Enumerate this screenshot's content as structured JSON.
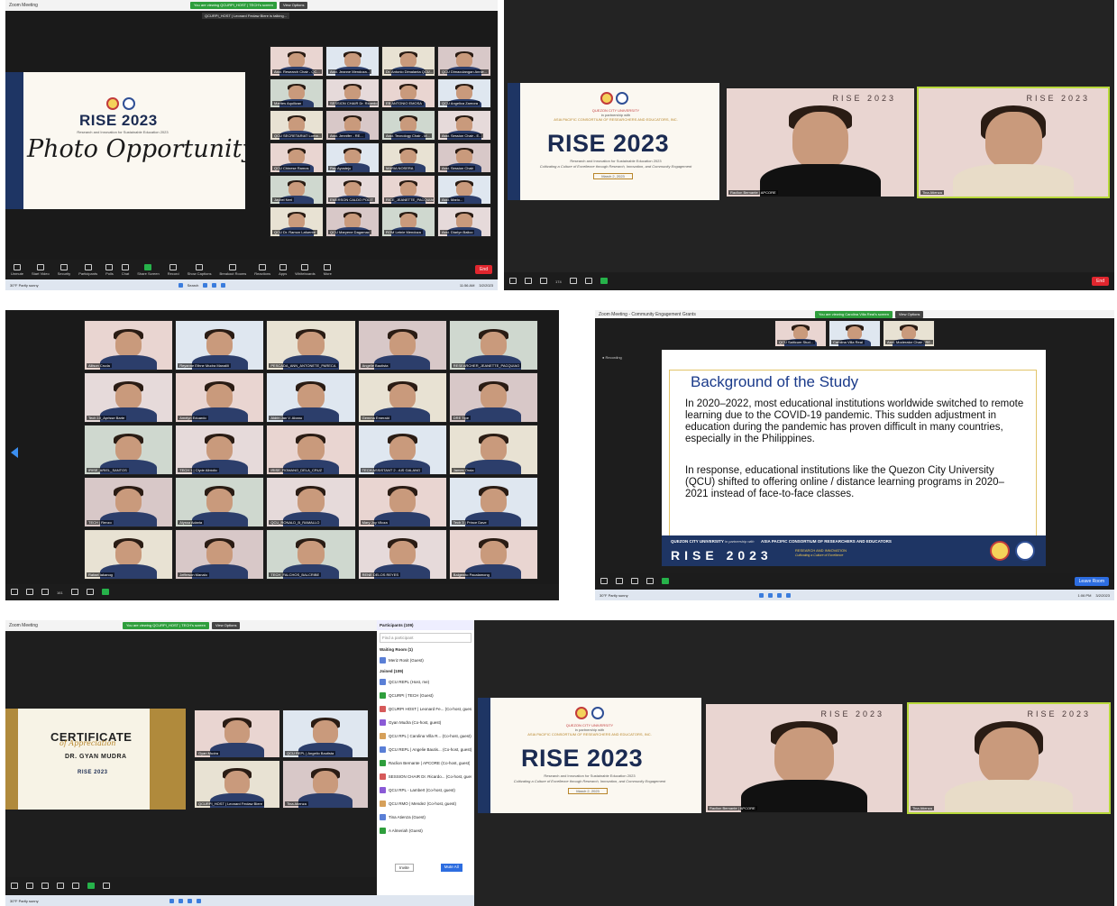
{
  "collage": {
    "shot1": {
      "titlebar": "Zoom Meeting",
      "banner": {
        "viewing": "You are viewing QCURPI_HOST | TECH's screen",
        "options": "View Options"
      },
      "talking": "QCURPI_HOST | Leonard Feclaw Biere is talking...",
      "slide": {
        "title": "RISE 2023",
        "caption": "Research and Innovation for Sustainable Education 2023",
        "script": "Photo Opportunity"
      },
      "tiles": [
        "Asst. Research Chair - QC...",
        "Asst. Jeanne Mendoza...",
        "Dr. Antonio Dimalanta QCU...",
        "QCU Dimaculangan Annie...",
        "Marites Aquilizan",
        "SESSION CHAIR Dr. Ricardo...",
        "EB ANTONIO EMOSA",
        "QCU Angelica Zamora",
        "QCU SECRETARIAT Lorna...",
        "Asst. Jennifer - RE...",
        "Asst. Tecnology Chair - M...",
        "Asst. Session Chair - E...",
        "QCU Chinese Ramos",
        "Ray Ayostejo",
        "MARIA NOSERA",
        "Asst. Session Chair",
        "Jaybel Neri",
        "EMERSON CALDO POLIT",
        "RICE_JEANETTE_PACQUIAO",
        "Asst. Mario...",
        "QCU Dr. Ramon Lafuente",
        "QCU Maryene Dagamac",
        "ROM Letnie Mendoza",
        "Asst. Diarlyn Balico"
      ],
      "toolbar": [
        "Unmute",
        "Start Video",
        "Security",
        "Participants",
        "Polls",
        "Chat",
        "Share Screen",
        "Record",
        "Show Captions",
        "Breakout Rooms",
        "Reactions",
        "Apps",
        "Whiteboards",
        "More"
      ],
      "end": "End",
      "taskbar": {
        "search": "Search",
        "weather": "30°F Partly sunny",
        "time": "11:56 AM",
        "date": "3/2/2023"
      }
    },
    "shot2": {
      "slide": {
        "uni": "QUEZON CITY UNIVERSITY",
        "partner": "in partnership with",
        "consortium": "ASIA PACIFIC CONSORTIUM OF RESEARCHERS AND EDUCATORS, INC.",
        "title": "RISE 2023",
        "caption": "Research and Innovation for Sustainable Education 2023",
        "tagline": "Cultivating a Culture of Excellence through Research, Innovation, and Community Engagement",
        "date": "March 2, 2023"
      },
      "tiles": [
        {
          "name": "Raclion Bernante | APCORE",
          "bg": "RISE 2023"
        },
        {
          "name": "Tina Atienza",
          "bg": "RISE 2023"
        }
      ],
      "toolbar": [
        "174"
      ],
      "end": "End"
    },
    "shot3": {
      "tiles": [
        "Allison Cruda",
        "Reyanne Ethne Mudra Manalili",
        "PESCADA_ANN_ANTONETE_PARECA",
        "Angelie Bautista",
        "RESEARCHER_JEANETTE_PACQUIAO",
        "Tech 10_Aprisse Barte",
        "Amelyn Eduardo",
        "Aldrin Jan V. Abano",
        "Gemma Emerald",
        "DRE Tipe",
        "IRISE_ARIEL_SANTOS",
        "TECH 1 | Clyde Albiolio",
        "IRISE_ROMANO_DELA_CRUZ",
        "TECH ASSISTANT 2 - AIS GALANG",
        "James Onda",
        "TECH | Renzo",
        "Alyssa Aclaria",
        "QCU_RONALD_B_RAMALLO",
        "Mary Joy Viloza",
        "Tech 3 | Prince Dave",
        "Rafael Iakanog",
        "Jefferson Manalo",
        "TECH_FALCHOS_BALCRIBE",
        "RENE DELOS REYES",
        "Balgenito Pacalamong"
      ],
      "toolbar": [
        "161"
      ]
    },
    "shot4": {
      "titlebar": "Zoom Meeting - Community Engagement Grants",
      "banner": {
        "viewing": "You are viewing Carolina Villa Real's screen",
        "options": "View Options"
      },
      "recording": "Recording",
      "waiting": {
        "text": "Marilyn Sindanum entered the waiting room",
        "admit": "Admit to Main Session",
        "view": "View"
      },
      "thumbs": [
        "QCU Saiticum Stud...",
        "Carolina Villa Real",
        "Asst. Moderator Chair - RE..."
      ],
      "slide": {
        "heading": "Background of the Study",
        "p1": "In 2020–2022, most educational institutions worldwide switched to remote learning due to the COVID-19 pandemic. This sudden adjustment in education during the pandemic has proven difficult in many countries, especially in the Philippines.",
        "p2": "In response, educational institutions like the Quezon City University (QCU) shifted to offering online / distance learning programs in 2020–2021 instead of face-to-face classes.",
        "footer_uni": "QUEZON CITY UNIVERSITY",
        "footer_partner": "in partnership with",
        "footer_consortium": "ASIA PACIFIC CONSORTIUM OF RESEARCHERS AND EDUCATORS",
        "footer_title": "RISE 2023",
        "footer_sub": "RESEARCH AND INNOVATION",
        "footer_tag": "Cultivating a Culture of Excellence"
      },
      "leave": "Leave Room",
      "taskbar": {
        "weather": "30°F Partly sunny",
        "time": "1:06 PM",
        "date": "3/2/2023"
      }
    },
    "shot5": {
      "titlebar": "Zoom Meeting",
      "banner": {
        "viewing": "You are viewing QCURPI_HOST | TECH's screen",
        "options": "View Options"
      },
      "cert": {
        "title": "CERTIFICATE",
        "script": "of Appreciation",
        "name": "DR. GYAN MUDRA",
        "event": "RISE 2023"
      },
      "tiles": [
        "Gyan Mudra",
        "QCU REPL | Angelio Bautista",
        "QCURPI_HOST | Leonard Feclaw Biere",
        "Tina Atienza"
      ],
      "panel": {
        "title": "Participants (109)",
        "search": "Find a participant",
        "waiting": "Waiting Room (1)",
        "waiting_person": "Meriz Rosit (Guest)",
        "joined": "Joined (109)",
        "people": [
          "QCU REPL (Host, me)",
          "QCURPI | TECH (Guest)",
          "QCURPI HOST | Leonard Fe... (Co-host, guest)",
          "Gyan Mudra (Co-host, guest)",
          "QCU RPL | Carolina Villa R... (Co-host, guest)",
          "QCU REPL | Angelie Bautis... (Co-host, guest)",
          "Raclion Bernante | APCORE (Co-host, guest)",
          "SESSION CHAIR Dr. Ricardo... (Co-host, guest)",
          "QCU RPL - Lambert (Co-host, guest)",
          "QCU RMO | Mendez (Co-host, guest)",
          "Tina Atienza (Guest)",
          "A Almeriah (Guest)"
        ],
        "invite": "Invite",
        "mute_all": "Mute All"
      },
      "taskbar": {
        "weather": "30°F Partly sunny"
      }
    },
    "shot6": {
      "slide": {
        "uni": "QUEZON CITY UNIVERSITY",
        "partner": "in partnership with",
        "consortium": "ASIA PACIFIC CONSORTIUM OF RESEARCHERS AND EDUCATORS, INC.",
        "title": "RISE 2023",
        "caption": "Research and Innovation for Sustainable Education 2023",
        "tagline": "Cultivating a Culture of Excellence through Research, Innovation, and Community Engagement",
        "date": "March 2, 2023"
      },
      "tiles": [
        {
          "name": "Raclion Bernante | APCORE",
          "bg": "RISE 2023"
        },
        {
          "name": "Tina Atienza",
          "bg": "RISE 2023"
        }
      ]
    }
  }
}
